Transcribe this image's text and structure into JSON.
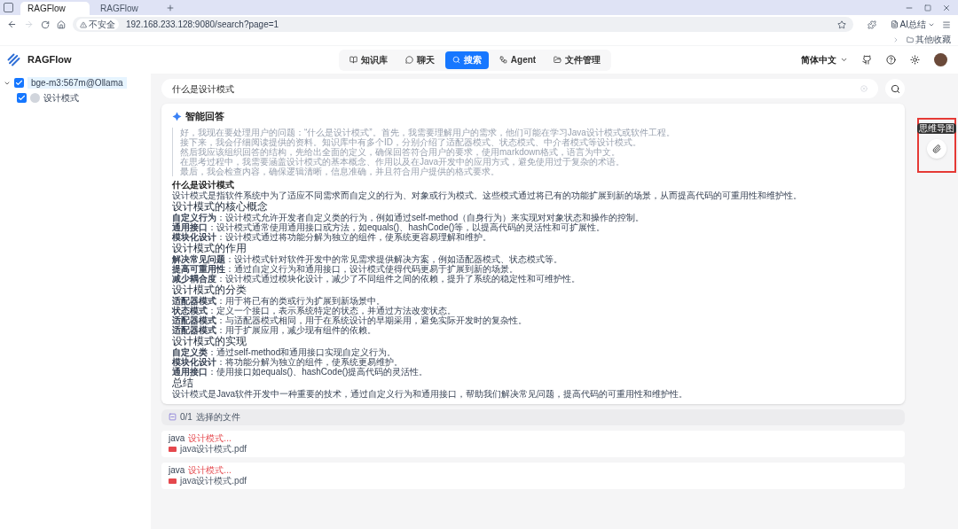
{
  "browser": {
    "tabs": [
      {
        "title": "RAGFlow",
        "selected": true
      },
      {
        "title": "RAGFlow",
        "selected": false
      }
    ],
    "security": "不安全",
    "url": "192.168.233.128:9080/search?page=1",
    "ai_button": "AI总结",
    "bookmarks_folder": "其他收藏"
  },
  "app": {
    "name": "RAGFlow",
    "nav": [
      {
        "label": "知识库",
        "selected": false
      },
      {
        "label": "聊天",
        "selected": false
      },
      {
        "label": "搜索",
        "selected": true
      },
      {
        "label": "Agent",
        "selected": false
      },
      {
        "label": "文件管理",
        "selected": false
      }
    ],
    "language": "简体中文"
  },
  "sidebar": {
    "tree": [
      {
        "label": "bge-m3:567m@Ollama",
        "checked": true,
        "expanded": true,
        "children": [
          {
            "label": "设计模式",
            "checked": true
          }
        ]
      }
    ]
  },
  "search": {
    "value": "什么是设计模式"
  },
  "answer": {
    "title": "智能回答",
    "thinking": [
      "好，我现在要处理用户的问题：“什么是设计模式”。首先，我需要理解用户的需求，他们可能在学习Java设计模式或软件工程。",
      "接下来，我会仔细阅读提供的资料。知识库中有多个ID，分别介绍了适配器模式、状态模式、中介者模式等设计模式。",
      "然后我应该组织回答的结构，先给出全面的定义，确保回答符合用户的要求，使用markdown格式，语言为中文。",
      "在思考过程中，我需要涵盖设计模式的基本概念、作用以及在Java开发中的应用方式，避免使用过于复杂的术语。",
      "最后，我会检查内容，确保逻辑清晰，信息准确，并且符合用户提供的格式要求。"
    ],
    "blocks": [
      {
        "kind": "subtitle",
        "text": "什么是设计模式"
      },
      {
        "kind": "paragraph",
        "text": "设计模式是指软件系统中为了适应不同需求而自定义的行为、对象或行为模式。这些模式通过将已有的功能扩展到新的场景，从而提高代码的可重用性和维护性。"
      },
      {
        "kind": "heading",
        "text": "设计模式的核心概念"
      },
      {
        "kind": "item",
        "text": "**自定义行为**：设计模式允许开发者自定义类的行为，例如通过self-method（自身行为）来实现对对象状态和操作的控制。"
      },
      {
        "kind": "item",
        "text": "**通用接口**：设计模式通常使用通用接口或方法，如equals()、hashCode()等，以提高代码的灵活性和可扩展性。"
      },
      {
        "kind": "item",
        "text": "**模块化设计**：设计模式通过将功能分解为独立的组件，使系统更容易理解和维护。"
      },
      {
        "kind": "heading",
        "text": "设计模式的作用"
      },
      {
        "kind": "item",
        "text": "**解决常见问题**：设计模式针对软件开发中的常见需求提供解决方案，例如适配器模式、状态模式等。"
      },
      {
        "kind": "item",
        "text": "**提高可重用性**：通过自定义行为和通用接口，设计模式使得代码更易于扩展到新的场景。"
      },
      {
        "kind": "item",
        "text": "**减少耦合度**：设计模式通过模块化设计，减少了不同组件之间的依赖，提升了系统的稳定性和可维护性。"
      },
      {
        "kind": "heading",
        "text": "设计模式的分类"
      },
      {
        "kind": "item",
        "text": "**适配器模式**：用于将已有的类或行为扩展到新场景中。"
      },
      {
        "kind": "item",
        "text": "**状态模式**：定义一个接口，表示系统特定的状态，并通过方法改变状态。"
      },
      {
        "kind": "item",
        "text": "**适配器模式**：与适配器模式相同，用于在系统设计的早期采用，避免实际开发时的复杂性。"
      },
      {
        "kind": "item",
        "text": "**适配器模式**：用于扩展应用，减少现有组件的依赖。"
      },
      {
        "kind": "heading",
        "text": "设计模式的实现"
      },
      {
        "kind": "item",
        "text": "**自定义类**：通过self-method和通用接口实现自定义行为。"
      },
      {
        "kind": "item",
        "text": "**模块化设计**：将功能分解为独立的组件，使系统更易维护。"
      },
      {
        "kind": "item",
        "text": "**通用接口**：使用接口如equals()、hashCode()提高代码的灵活性。"
      },
      {
        "kind": "heading",
        "text": "总结"
      },
      {
        "kind": "paragraph",
        "text": "设计模式是Java软件开发中一种重要的技术，通过自定义行为和通用接口，帮助我们解决常见问题，提高代码的可重用性和维护性。"
      }
    ]
  },
  "file_filter": {
    "count": "0/1",
    "label": "选择的文件"
  },
  "results": [
    {
      "prefix": "java",
      "highlight": "设计模式...",
      "file": "java设计模式.pdf"
    },
    {
      "prefix": "java",
      "highlight": "设计模式...",
      "file": "java设计模式.pdf"
    }
  ],
  "float_tool": {
    "tooltip": "思维导图"
  }
}
